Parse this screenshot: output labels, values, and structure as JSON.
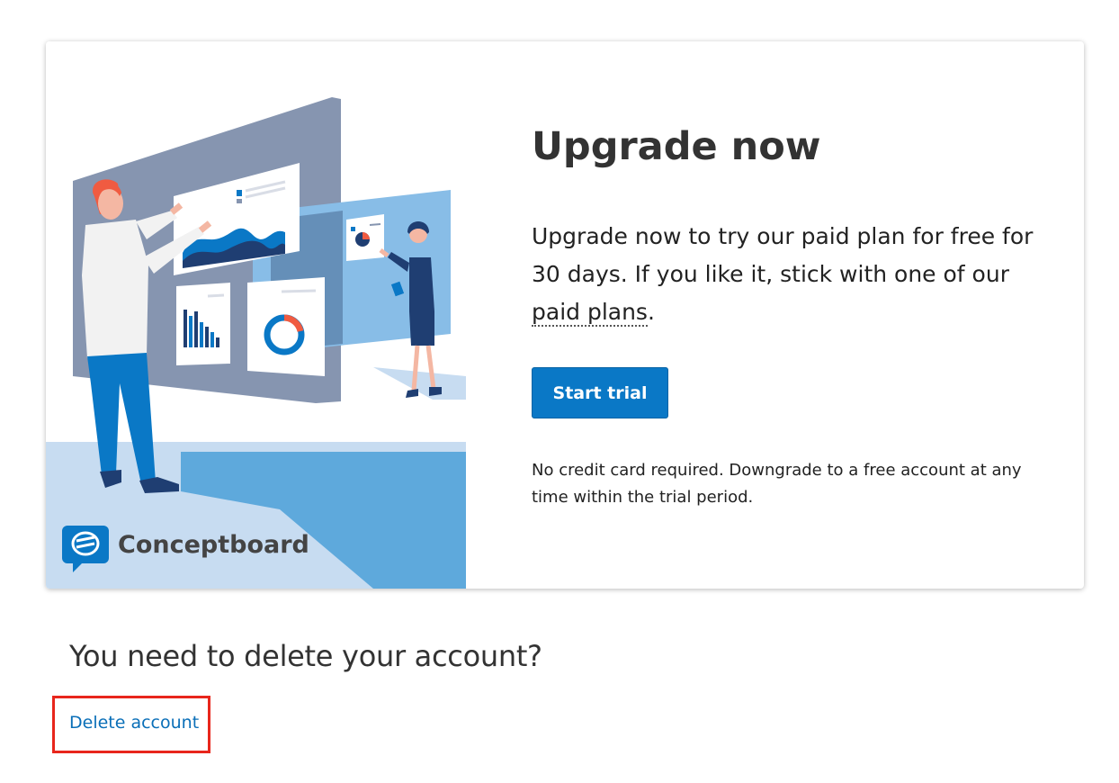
{
  "upgrade_card": {
    "title": "Upgrade now",
    "description_before_link": "Upgrade now to try our paid plan for free for 30 days. If you like it, stick with one of our ",
    "paid_plans_link": "paid plans",
    "description_after_link": ".",
    "start_trial_label": "Start trial",
    "note": "No credit card required. Downgrade to a free account at any time within the trial period.",
    "illustration": {
      "brand_name": "Conceptboard",
      "logo_icon": "speech-bubble-logo-icon"
    }
  },
  "delete_section": {
    "heading": "You need to delete your account?",
    "delete_link_label": "Delete account",
    "highlight_color": "#e8261c"
  },
  "colors": {
    "accent": "#0a78c6",
    "link": "#0a6fb8",
    "text": "#222222"
  }
}
